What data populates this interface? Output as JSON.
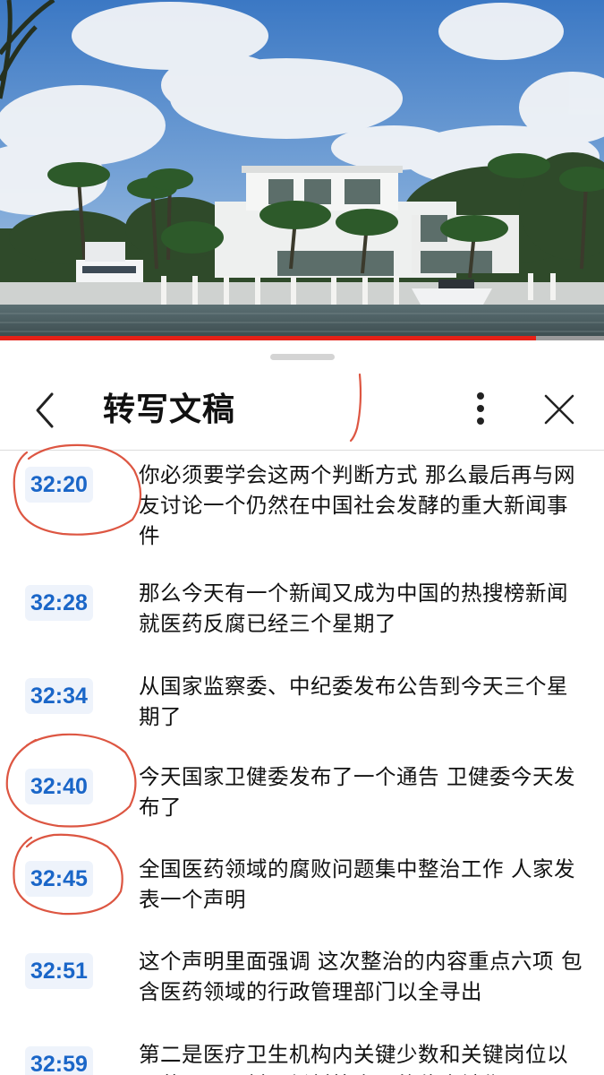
{
  "video": {
    "progress": 0.887
  },
  "header": {
    "title": "转写文稿",
    "back_icon": "chevron-left-icon",
    "more_icon": "more-vertical-icon",
    "close_icon": "close-icon"
  },
  "transcript": [
    {
      "time": "32:20",
      "text": "你必须要学会这两个判断方式 那么最后再与网友讨论一个仍然在中国社会发酵的重大新闻事件"
    },
    {
      "time": "32:28",
      "text": "那么今天有一个新闻又成为中国的热搜榜新闻 就医药反腐已经三个星期了"
    },
    {
      "time": "32:34",
      "text": "从国家监察委、中纪委发布公告到今天三个星期了"
    },
    {
      "time": "32:40",
      "text": "今天国家卫健委发布了一个通告 卫健委今天发布了"
    },
    {
      "time": "32:45",
      "text": "全国医药领域的腐败问题集中整治工作 人家发表一个声明"
    },
    {
      "time": "32:51",
      "text": "这个声明里面强调 这次整治的内容重点六项 包含医药领域的行政管理部门以全寻出"
    },
    {
      "time": "32:59",
      "text": "第二是医疗卫生机构内关键少数和关键岗位以及药品、器材、耗材等方面的位命销售"
    }
  ],
  "colors": {
    "accent": "#1a66c8",
    "timestamp_bg": "#eef3fb",
    "progress": "#e62117",
    "ink": "#d9442e"
  }
}
